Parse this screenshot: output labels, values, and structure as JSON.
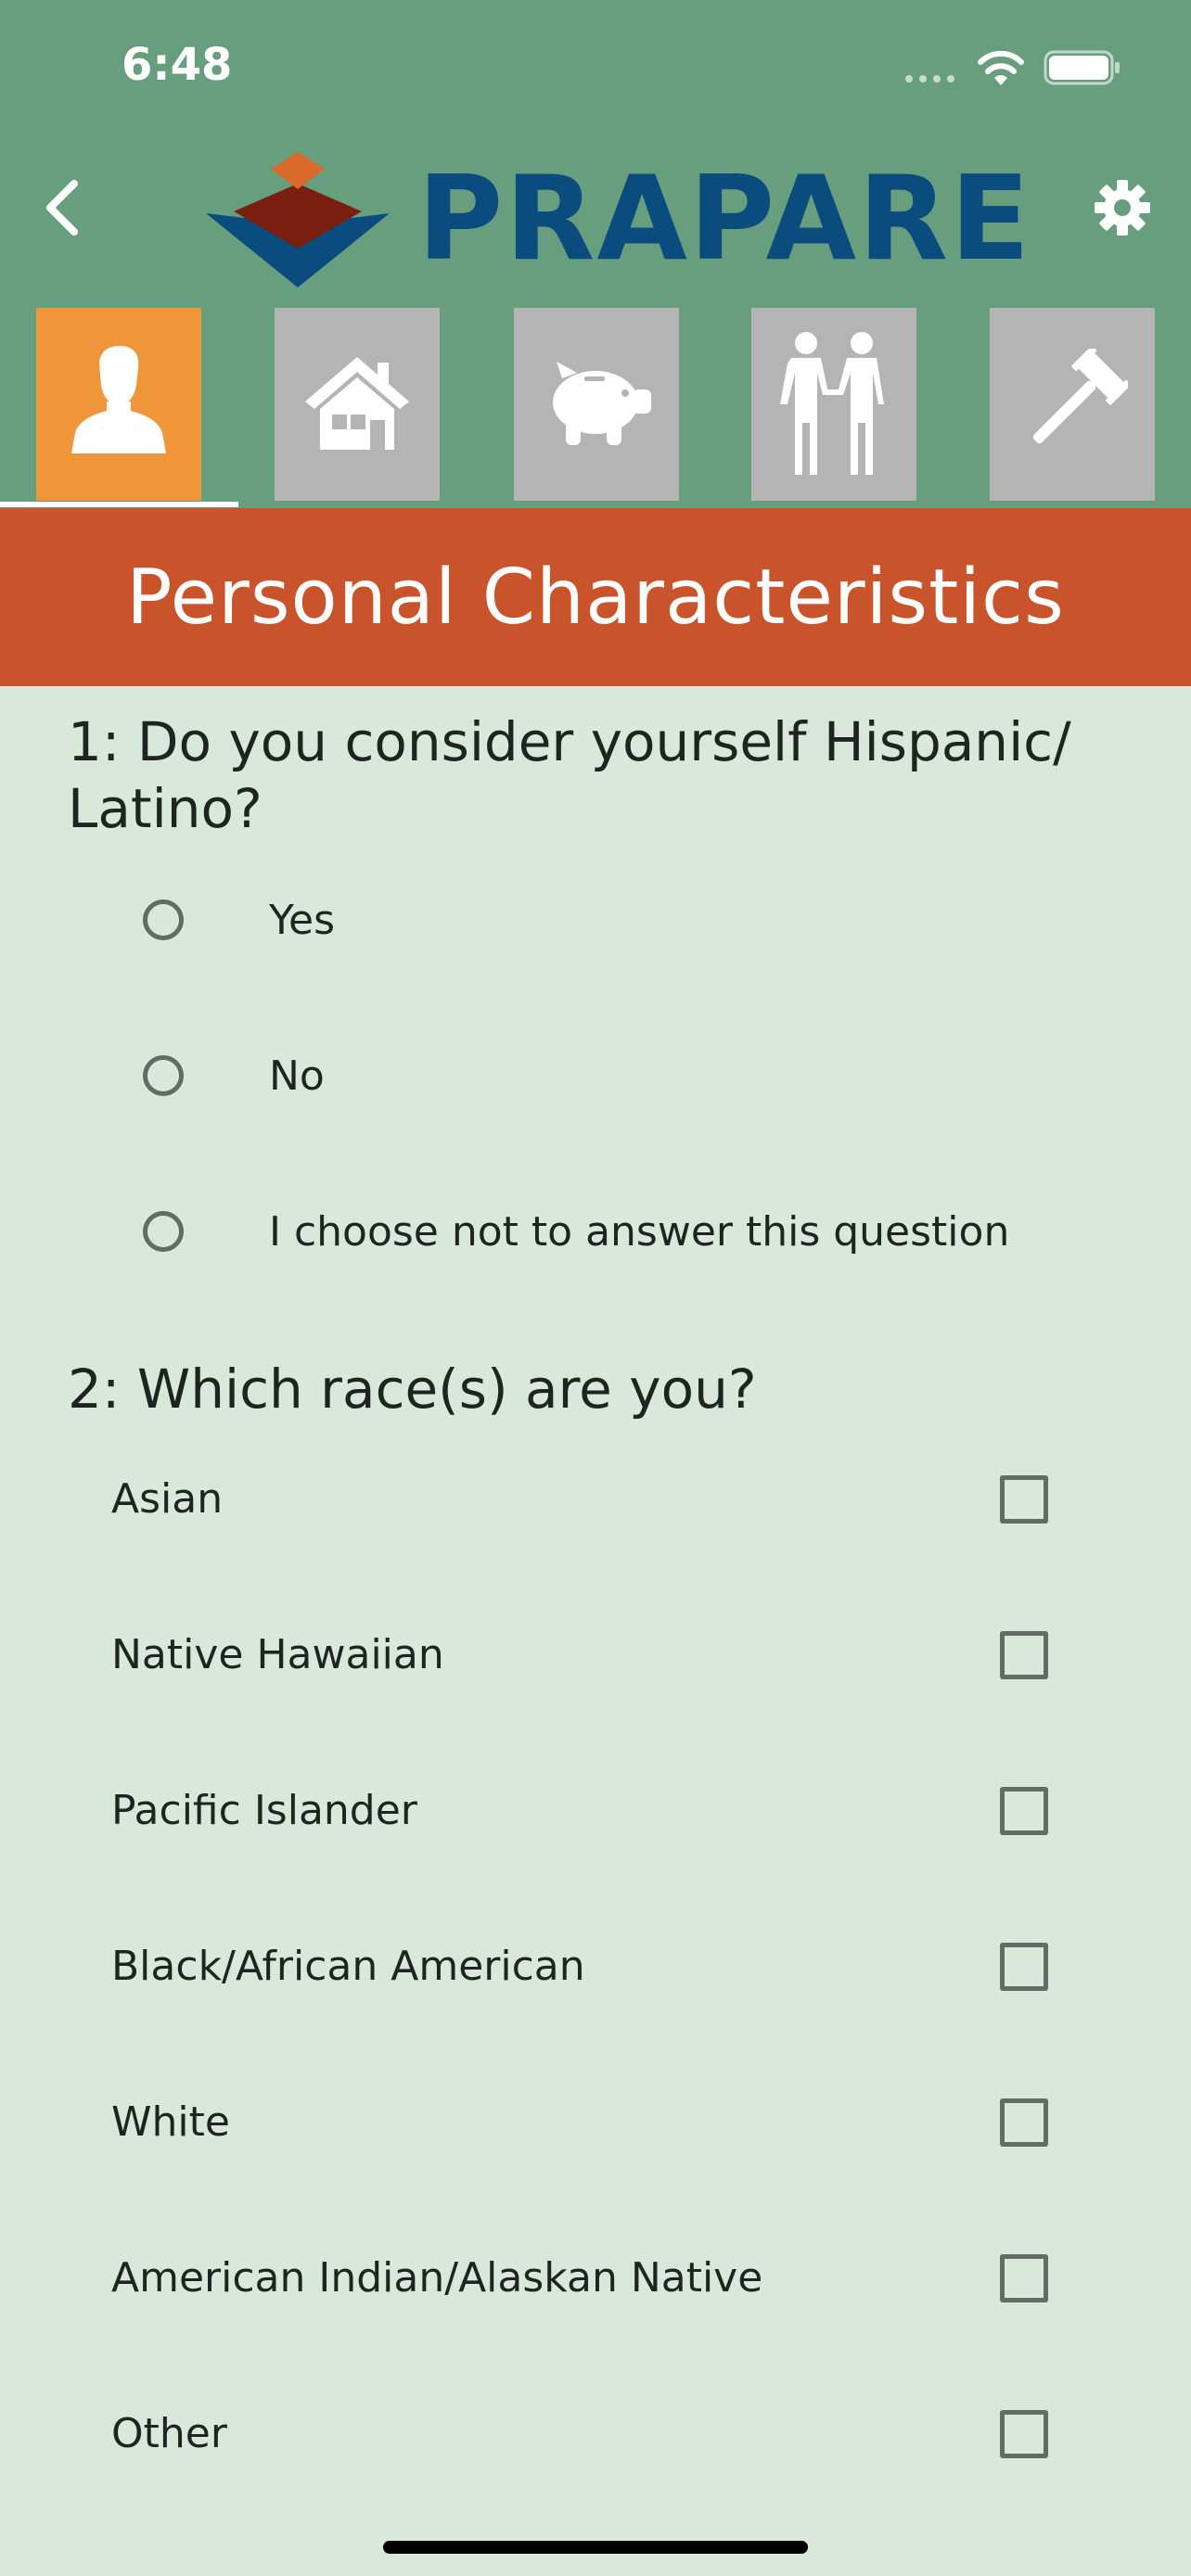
{
  "status_bar": {
    "time": "6:48",
    "icons": [
      "cellular-signal-icon",
      "wifi-icon",
      "battery-icon"
    ]
  },
  "header": {
    "back_icon": "chevron-left-icon",
    "logo_text": "PRAPARE",
    "settings_icon": "gear-icon",
    "colors": {
      "bar": "#679e7d",
      "logo_blue": "#0b4c7e",
      "logo_orange": "#d96a2b",
      "logo_brown": "#7a1e10"
    }
  },
  "tabs": [
    {
      "icon": "person-icon",
      "active": true
    },
    {
      "icon": "house-icon",
      "active": false
    },
    {
      "icon": "piggy-bank-icon",
      "active": false
    },
    {
      "icon": "people-holding-hands-icon",
      "active": false
    },
    {
      "icon": "gavel-icon",
      "active": false
    }
  ],
  "section": {
    "title": "Personal Characteristics",
    "color": "#c9542c"
  },
  "questions": [
    {
      "label": "1: Do you consider yourself Hispanic/ Latino?",
      "type": "radio",
      "options": [
        "Yes",
        "No",
        "I choose not to answer this question"
      ]
    },
    {
      "label": "2: Which race(s) are you?",
      "type": "checkbox",
      "options": [
        "Asian",
        "Native Hawaiian",
        "Pacific Islander",
        "Black/African American",
        "White",
        "American Indian/Alaskan Native",
        "Other"
      ]
    }
  ]
}
